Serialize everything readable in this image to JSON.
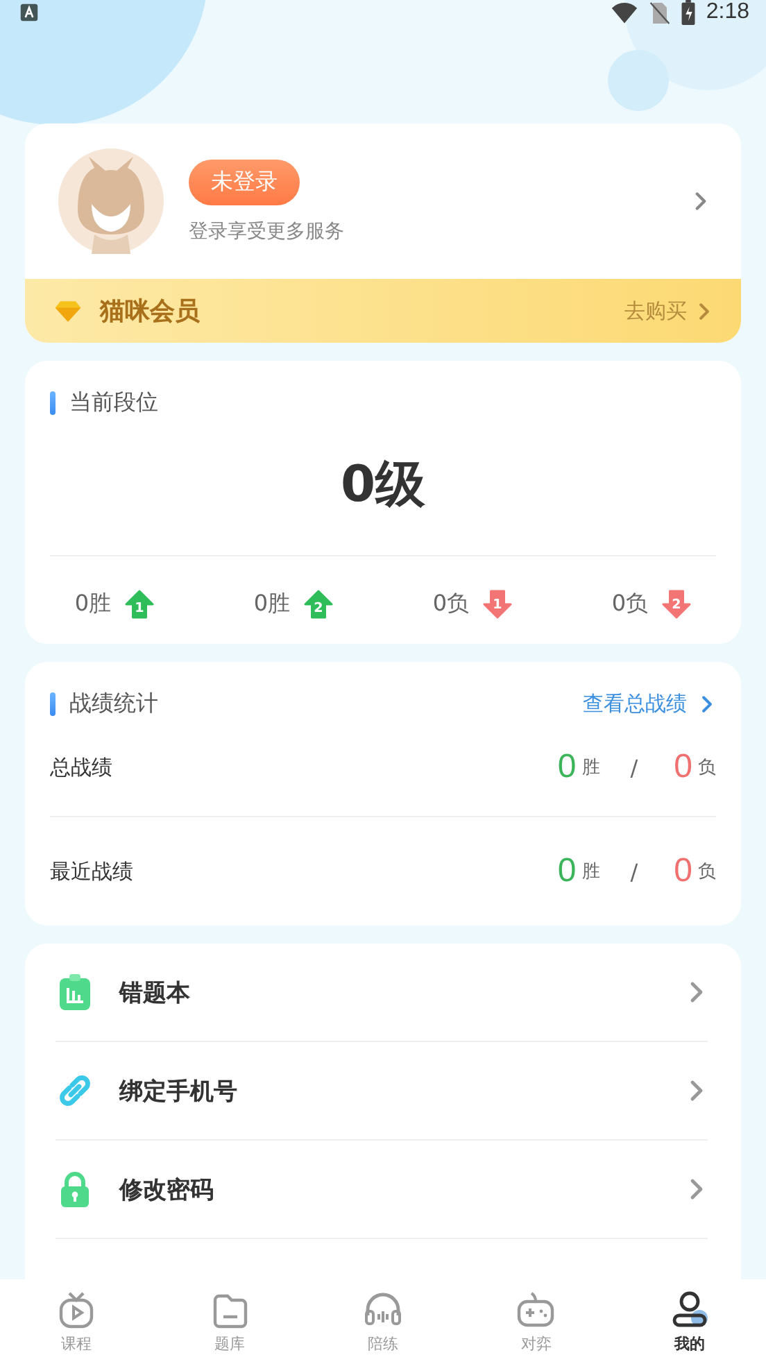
{
  "status_bar": {
    "time": "2:18"
  },
  "profile": {
    "badge": "未登录",
    "subtitle": "登录享受更多服务"
  },
  "vip": {
    "title": "猫咪会员",
    "action": "去购买"
  },
  "rank": {
    "title": "当前段位",
    "level": "0级",
    "stats": [
      {
        "value": "0胜",
        "kind": "up",
        "badge": "1"
      },
      {
        "value": "0胜",
        "kind": "up",
        "badge": "2"
      },
      {
        "value": "0负",
        "kind": "down",
        "badge": "1"
      },
      {
        "value": "0负",
        "kind": "down",
        "badge": "2"
      }
    ]
  },
  "record": {
    "title": "战绩统计",
    "link": "查看总战绩",
    "rows": [
      {
        "label": "总战绩",
        "wins": "0",
        "win_unit": "胜",
        "separator": "/",
        "losses": "0",
        "loss_unit": "负"
      },
      {
        "label": "最近战绩",
        "wins": "0",
        "win_unit": "胜",
        "separator": "/",
        "losses": "0",
        "loss_unit": "负"
      }
    ]
  },
  "menu": [
    {
      "label": "错题本",
      "kind": "chart"
    },
    {
      "label": "绑定手机号",
      "kind": "link"
    },
    {
      "label": "修改密码",
      "kind": "lock"
    }
  ],
  "tabs": [
    {
      "label": "课程",
      "selected": false
    },
    {
      "label": "题库",
      "selected": false
    },
    {
      "label": "陪练",
      "selected": false
    },
    {
      "label": "对弈",
      "selected": false
    },
    {
      "label": "我的",
      "selected": true
    }
  ]
}
